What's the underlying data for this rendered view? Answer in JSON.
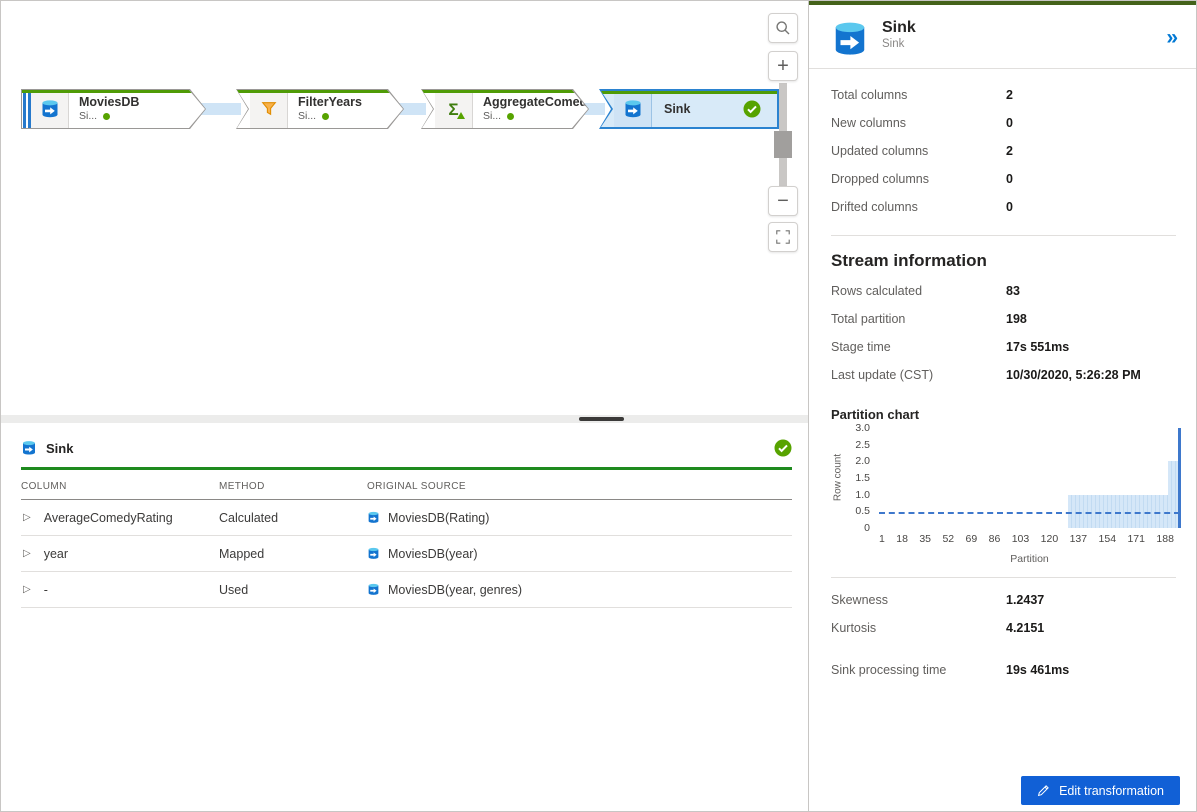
{
  "canvas": {
    "nodes": [
      {
        "name": "MoviesDB",
        "subtitle": "Si...",
        "kind": "source"
      },
      {
        "name": "FilterYears",
        "subtitle": "Si...",
        "kind": "filter"
      },
      {
        "name": "AggregateComed...",
        "subtitle": "Si...",
        "kind": "aggregate"
      },
      {
        "name": "Sink",
        "kind": "sink",
        "selected": true,
        "status": "succeeded"
      }
    ],
    "zoom_tools": {
      "zoom_in_label": "+",
      "zoom_out_label": "−"
    }
  },
  "mapping_panel": {
    "title": "Sink",
    "status": "succeeded",
    "columns": [
      "COLUMN",
      "METHOD",
      "ORIGINAL SOURCE"
    ],
    "rows": [
      {
        "column": "AverageComedyRating",
        "method": "Calculated",
        "source": "MoviesDB(Rating)"
      },
      {
        "column": "year",
        "method": "Mapped",
        "source": "MoviesDB(year)"
      },
      {
        "column": "-",
        "method": "Used",
        "source": "MoviesDB(year, genres)"
      }
    ]
  },
  "details_panel": {
    "title": "Sink",
    "subtitle": "Sink",
    "column_stats": [
      {
        "label": "Total columns",
        "value": "2"
      },
      {
        "label": "New columns",
        "value": "0"
      },
      {
        "label": "Updated columns",
        "value": "2"
      },
      {
        "label": "Dropped columns",
        "value": "0"
      },
      {
        "label": "Drifted columns",
        "value": "0"
      }
    ],
    "stream_information": {
      "heading": "Stream information",
      "rows": [
        {
          "label": "Rows calculated",
          "value": "83"
        },
        {
          "label": "Total partition",
          "value": "198"
        },
        {
          "label": "Stage time",
          "value": "17s 551ms"
        },
        {
          "label": "Last update (CST)",
          "value": "10/30/2020, 5:26:28 PM"
        }
      ]
    },
    "distribution": [
      {
        "label": "Skewness",
        "value": "1.2437"
      },
      {
        "label": "Kurtosis",
        "value": "4.2151"
      }
    ],
    "processing": {
      "label": "Sink processing time",
      "value": "19s 461ms"
    },
    "edit_button_label": "Edit transformation"
  },
  "chart_data": {
    "type": "bar",
    "title": "Partition chart",
    "xlabel": "Partition",
    "ylabel": "Row count",
    "ylim": [
      0,
      3.0
    ],
    "ytick_labels": [
      "3.0",
      "2.5",
      "2.0",
      "1.5",
      "1.0",
      "0.5",
      "0"
    ],
    "xtick_labels": [
      "1",
      "18",
      "35",
      "52",
      "69",
      "86",
      "103",
      "120",
      "137",
      "154",
      "171",
      "188"
    ],
    "x_range": [
      1,
      198
    ],
    "average_row_count": 0.42,
    "segments": [
      {
        "from": 1,
        "to": 124,
        "row_count": 0
      },
      {
        "from": 125,
        "to": 190,
        "row_count": 1
      },
      {
        "from": 191,
        "to": 197,
        "row_count": 2
      },
      {
        "from": 198,
        "to": 198,
        "row_count": 3,
        "emphasis": true
      }
    ],
    "legend": "none",
    "grid": "off"
  },
  "colors": {
    "accent_blue": "#0078d4",
    "button_blue": "#1160d6",
    "node_top_green": "#4f9b06",
    "success_green": "#57a300",
    "panel_top_green": "#44621a",
    "table_rule_green": "#1e8a1e",
    "chart_bar_light": "#d5e7f8",
    "chart_accent": "#3e78cc"
  }
}
